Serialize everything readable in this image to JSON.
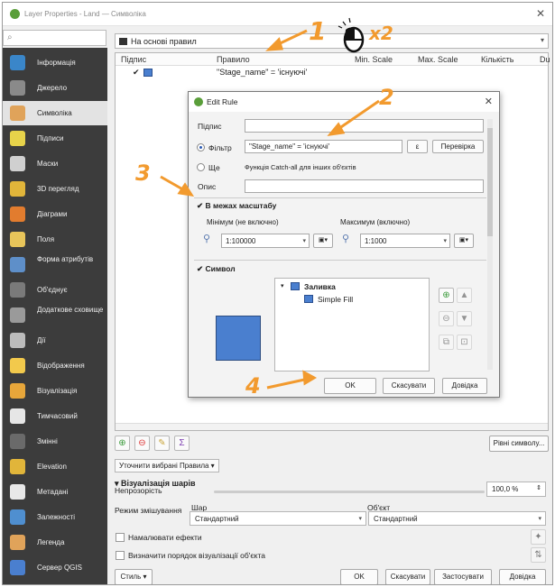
{
  "window": {
    "title": "Layer Properties - Land — Символіка",
    "close": "✕"
  },
  "search": {
    "placeholder": ""
  },
  "sidebar": {
    "items": [
      {
        "label": "Інформація",
        "icon": "info-icon",
        "color": "#3a86c9"
      },
      {
        "label": "Джерело",
        "icon": "source-icon",
        "color": "#8a8a8a"
      },
      {
        "label": "Символіка",
        "icon": "symbology-icon",
        "color": "#e0a35a",
        "active": true
      },
      {
        "label": "Підписи",
        "icon": "labels-icon",
        "color": "#e7d34a"
      },
      {
        "label": "Маски",
        "icon": "masks-icon",
        "color": "#d0d0d0"
      },
      {
        "label": "3D перегляд",
        "icon": "3d-view-icon",
        "color": "#e1b53a"
      },
      {
        "label": "Діаграми",
        "icon": "diagrams-icon",
        "color": "#e27c2e"
      },
      {
        "label": "Поля",
        "icon": "fields-icon",
        "color": "#e8c55a"
      },
      {
        "label": "Форма атрибутів",
        "icon": "attributes-form-icon",
        "color": "#5e8fc9"
      },
      {
        "label": "Об'єднує",
        "icon": "joins-icon",
        "color": "#7a7a7a"
      },
      {
        "label": "Додаткове сховище",
        "icon": "auxiliary-storage-icon",
        "color": "#9a9a9a"
      },
      {
        "label": "Дії",
        "icon": "actions-icon",
        "color": "#bcbcbc"
      },
      {
        "label": "Відображення",
        "icon": "display-icon",
        "color": "#f2c94c"
      },
      {
        "label": "Візуалізація",
        "icon": "rendering-icon",
        "color": "#e7a63a"
      },
      {
        "label": "Тимчасовий",
        "icon": "temporal-icon",
        "color": "#e6e6e6"
      },
      {
        "label": "Змінні",
        "icon": "variables-icon",
        "color": "#6a6a6a"
      },
      {
        "label": "Elevation",
        "icon": "elevation-icon",
        "color": "#e1b53a"
      },
      {
        "label": "Метадані",
        "icon": "metadata-icon",
        "color": "#e8e8e8"
      },
      {
        "label": "Залежності",
        "icon": "dependencies-icon",
        "color": "#4f8fd0"
      },
      {
        "label": "Легенда",
        "icon": "legend-icon",
        "color": "#e0a35a"
      },
      {
        "label": "Сервер QGIS",
        "icon": "qgis-server-icon",
        "color": "#4a7fcf"
      }
    ]
  },
  "renderer": {
    "selected": "На основі правил"
  },
  "tree": {
    "headers": [
      "Підпис",
      "Правило",
      "Min. Scale",
      "Max. Scale",
      "Кількість",
      "Du"
    ],
    "row": {
      "rule": "\"Stage_name\" = 'існуючі'"
    }
  },
  "toolbar": {
    "symbol_levels": "Рівні символу..."
  },
  "refine": {
    "label": "Уточнити вибрані Правила"
  },
  "layer_rendering": {
    "section": "Візуалізація шарів",
    "opacity_label": "Непрозорість",
    "opacity_value": "100,0 %",
    "blend_label": "Режим змішування",
    "layer_label": "Шар",
    "feature_label": "Об'єкт",
    "layer_value": "Стандартний",
    "feature_value": "Стандартний",
    "draw_effects": "Намалювати ефекти",
    "control_order": "Визначити порядок візуалізації об'єкта"
  },
  "footer": {
    "style": "Стиль",
    "ok": "OK",
    "cancel": "Скасувати",
    "apply": "Застосувати",
    "help": "Довідка"
  },
  "dialog": {
    "title": "Edit Rule",
    "close": "✕",
    "label_label": "Підпис",
    "filter_label": "Фільтр",
    "filter_value": "\"Stage_name\" = 'існуючі'",
    "epsilon": "ε",
    "test": "Перевірка",
    "else_label": "Ще",
    "else_desc": "Функція Catch-all для інших об'єктів",
    "desc_label": "Опис",
    "scale_section": "В межах масштабу",
    "min_label": "Мінімум (не включно)",
    "max_label": "Максимум (включно)",
    "min_value": "1:100000",
    "max_value": "1:1000",
    "symbol_section": "Символ",
    "fill": "Заливка",
    "simple_fill": "Simple Fill",
    "ok": "OK",
    "cancel": "Скасувати",
    "help": "Довідка"
  },
  "annotations": {
    "n1": "1",
    "n2": "2",
    "n3": "3",
    "n4": "4",
    "x2": "x2"
  },
  "colors": {
    "accent": "#f29a2e",
    "symbol": "#4a7fcf"
  }
}
